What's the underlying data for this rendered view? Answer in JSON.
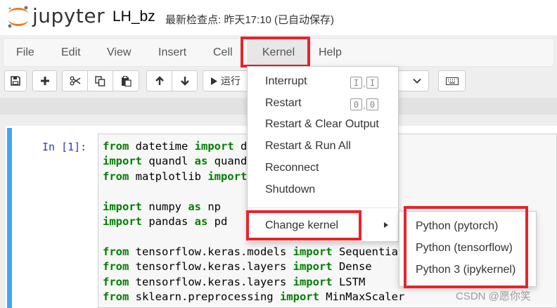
{
  "header": {
    "logo_text": "jupyter",
    "notebook_name": "LH_bz",
    "save_status": "最新检查点: 昨天17:10   (已自动保存)"
  },
  "menu": {
    "file": "File",
    "edit": "Edit",
    "view": "View",
    "insert": "Insert",
    "cell": "Cell",
    "kernel": "Kernel",
    "help": "Help"
  },
  "toolbar": {
    "run_label": "运行"
  },
  "kernel_menu": {
    "interrupt": "Interrupt",
    "interrupt_shortcut": [
      "I",
      "I"
    ],
    "restart": "Restart",
    "restart_shortcut": [
      "0",
      "0"
    ],
    "restart_clear": "Restart & Clear Output",
    "restart_run_all": "Restart & Run All",
    "reconnect": "Reconnect",
    "shutdown": "Shutdown",
    "change_kernel": "Change kernel"
  },
  "kernels": [
    "Python (pytorch)",
    "Python (tensorflow)",
    "Python 3 (ipykernel)"
  ],
  "cell": {
    "prompt": "In  [1]:",
    "lines": [
      [
        {
          "k": "from"
        },
        {
          "t": " datetime "
        },
        {
          "k": "import"
        },
        {
          "t": " d"
        }
      ],
      [
        {
          "k": "import"
        },
        {
          "t": " quandl "
        },
        {
          "k": "as"
        },
        {
          "t": " quand"
        }
      ],
      [
        {
          "k": "from"
        },
        {
          "t": " matplotlib "
        },
        {
          "k": "import"
        }
      ],
      [],
      [
        {
          "k": "import"
        },
        {
          "t": " numpy "
        },
        {
          "k": "as"
        },
        {
          "t": " np"
        }
      ],
      [
        {
          "k": "import"
        },
        {
          "t": " pandas "
        },
        {
          "k": "as"
        },
        {
          "t": " pd"
        }
      ],
      [],
      [
        {
          "k": "from"
        },
        {
          "t": " tensorflow.keras.models "
        },
        {
          "k": "import"
        },
        {
          "t": " Sequential"
        }
      ],
      [
        {
          "k": "from"
        },
        {
          "t": " tensorflow.keras.layers "
        },
        {
          "k": "import"
        },
        {
          "t": " Dense"
        }
      ],
      [
        {
          "k": "from"
        },
        {
          "t": " tensorflow.keras.layers "
        },
        {
          "k": "import"
        },
        {
          "t": " LSTM"
        }
      ],
      [
        {
          "k": "from"
        },
        {
          "t": " sklearn.preprocessing "
        },
        {
          "k": "import"
        },
        {
          "t": " MinMaxScaler"
        }
      ]
    ]
  },
  "watermark": "CSDN @愿你笑",
  "colors": {
    "highlight_box": "#e8232b",
    "cell_selected": "#42a5f5",
    "keyword": "#008000",
    "prompt": "#303f9f"
  },
  "icons": [
    "save-icon",
    "plus-icon",
    "scissors-icon",
    "copy-icon",
    "paste-icon",
    "arrow-up-icon",
    "arrow-down-icon",
    "play-icon",
    "keyboard-icon",
    "chevron-down-icon",
    "caret-right-icon"
  ]
}
